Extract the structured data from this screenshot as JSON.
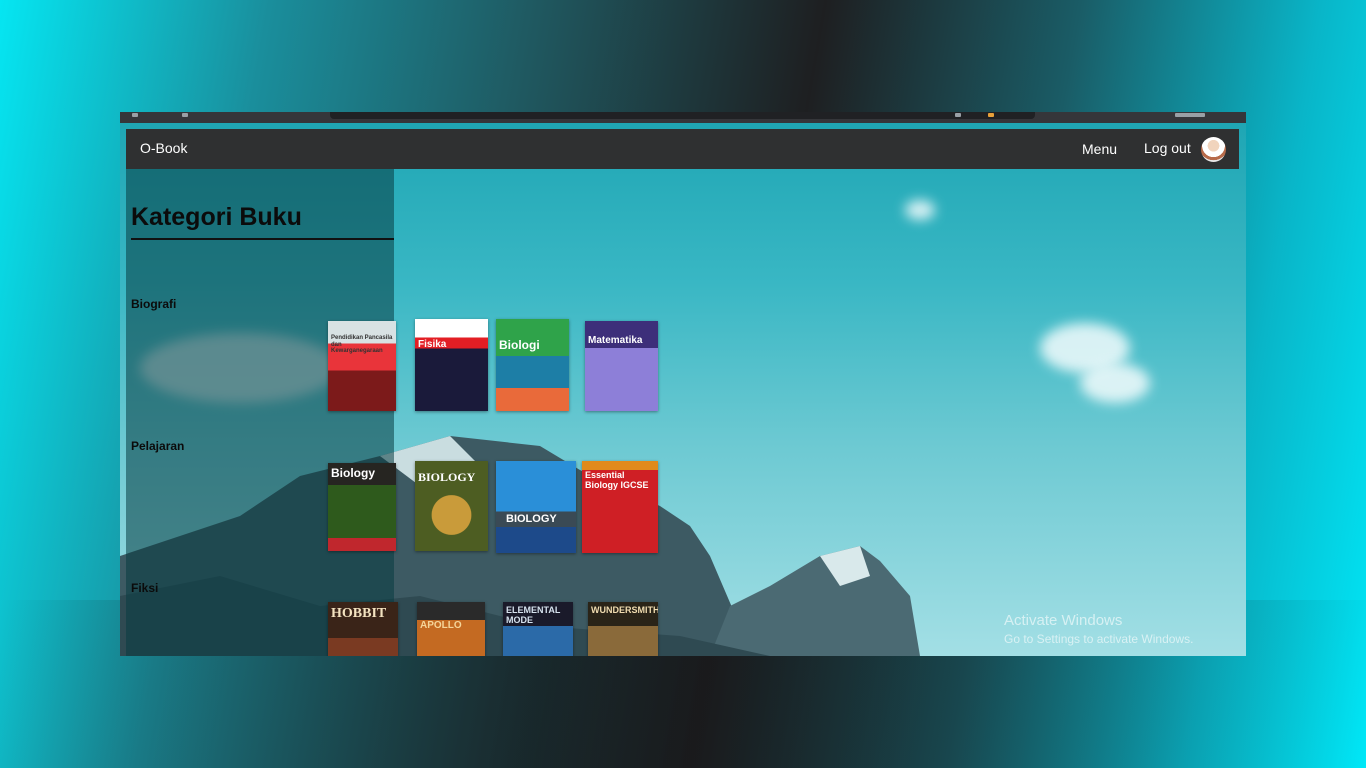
{
  "navbar": {
    "brand": "O-Book",
    "menu_label": "Menu",
    "logout_label": "Log out"
  },
  "sidebar": {
    "title": "Kategori Buku",
    "categories": [
      {
        "label": "Biografi"
      },
      {
        "label": "Pelajaran"
      },
      {
        "label": "Fiksi"
      }
    ]
  },
  "books": {
    "row1": [
      {
        "title": "Pendidikan Pancasila dan Kewarganegaraan",
        "color": "#b9c7c8"
      },
      {
        "title": "Fisika",
        "color": "#e31e24"
      },
      {
        "title": "Biologi",
        "color": "#2fa34a"
      },
      {
        "title": "Matematika",
        "color": "#6b5db8"
      }
    ],
    "row2": [
      {
        "title": "Biology",
        "color": "#2b2a22"
      },
      {
        "title": "BIOLOGY",
        "color": "#6b7a2a"
      },
      {
        "title": "BIOLOGY",
        "color": "#1a56a8"
      },
      {
        "title": "Essential Biology IGCSE",
        "color": "#d61f26"
      }
    ],
    "row3": [
      {
        "title": "HOBBIT",
        "color": "#3a2418"
      },
      {
        "title": "APOLLO",
        "color": "#a8581e"
      },
      {
        "title": "ELEMENTAL MODE",
        "color": "#1e4f78"
      },
      {
        "title": "WUNDERSMITH",
        "color": "#5a4a2a"
      }
    ]
  },
  "watermark": {
    "line1": "Activate Windows",
    "line2": "Go to Settings to activate Windows."
  }
}
